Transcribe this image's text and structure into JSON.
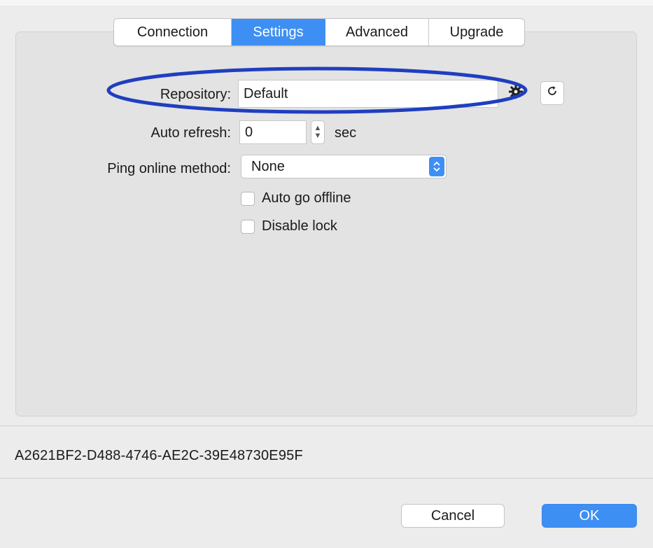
{
  "tabs": [
    {
      "label": "Connection",
      "active": false
    },
    {
      "label": "Settings",
      "active": true
    },
    {
      "label": "Advanced",
      "active": false
    },
    {
      "label": "Upgrade",
      "active": false
    }
  ],
  "settings": {
    "repository_label": "Repository:",
    "repository_value": "Default",
    "auto_refresh_label": "Auto refresh:",
    "auto_refresh_value": "0",
    "auto_refresh_unit": "sec",
    "ping_label": "Ping online method:",
    "ping_value": "None",
    "auto_go_offline_label": "Auto go offline",
    "auto_go_offline_checked": false,
    "disable_lock_label": "Disable lock",
    "disable_lock_checked": false
  },
  "identifier": "A2621BF2-D488-4746-AE2C-39E48730E95F",
  "buttons": {
    "cancel": "Cancel",
    "ok": "OK"
  },
  "icons": {
    "repository_settings": "gear-icon",
    "repository_refresh": "refresh-icon",
    "stepper": "stepper-icon",
    "popup_arrows": "up-down-chevron-icon"
  },
  "colors": {
    "accent": "#3e8ff4",
    "highlight_ellipse": "#1f3fbf",
    "window_bg": "#ececec"
  }
}
